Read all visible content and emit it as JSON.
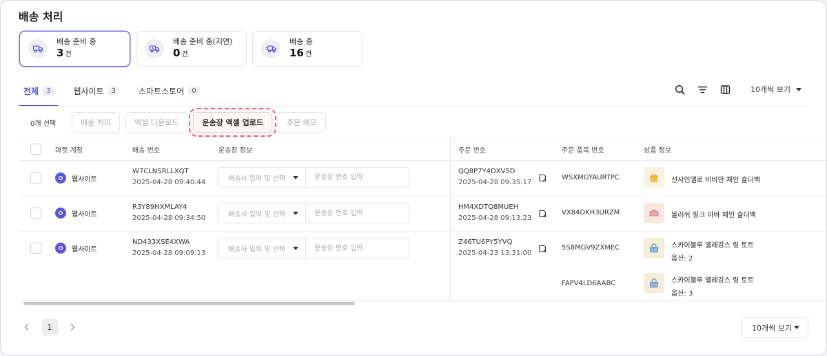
{
  "page": {
    "title": "배송 처리"
  },
  "status_cards": [
    {
      "label": "배송 준비 중",
      "count": "3",
      "unit": "건",
      "active": true,
      "icon": "truck-icon"
    },
    {
      "label": "배송 준비 중(지연)",
      "count": "0",
      "unit": "건",
      "active": false,
      "icon": "truck-delay-icon"
    },
    {
      "label": "배송 중",
      "count": "16",
      "unit": "건",
      "active": false,
      "icon": "truck-moving-icon"
    }
  ],
  "tabs": [
    {
      "label": "전체",
      "count": "3",
      "active": true
    },
    {
      "label": "웹사이트",
      "count": "3",
      "active": false
    },
    {
      "label": "스마트스토어",
      "count": "0",
      "active": false
    }
  ],
  "toolbar": {
    "view_select": "10개씩 보기"
  },
  "actions": {
    "selected_count": "0개 선택",
    "ship_process": "배송 처리",
    "excel_download": "엑셀 다운로드",
    "waybill_upload": "운송장 엑셀 업로드",
    "order_memo": "주문 메모"
  },
  "table": {
    "headers": {
      "market": "마켓 계정",
      "ship_no": "배송 번호",
      "waybill": "운송장 정보",
      "order_no": "주문 번호",
      "item_no": "주문 품목 번호",
      "product": "상품 정보"
    },
    "carrier_placeholder": "배송사 입력 및 선택",
    "tracking_placeholder": "운송장 번호 입력",
    "rows": [
      {
        "market": "웹사이트",
        "ship_no": "W7CLNSRLLXQT",
        "ship_time": "2025-04-28 09:40:44",
        "order_no": "QQ8P7Y4DXV5D",
        "order_time": "2025-04-28 09:35:17",
        "items": [
          {
            "item_no": "WSXMGYAURTPC",
            "product": "선사인옐로 비비안 체인 숄더백",
            "option": ""
          }
        ]
      },
      {
        "market": "웹사이트",
        "ship_no": "R3Y89HXMLAY4",
        "ship_time": "2025-04-28 09:34:50",
        "order_no": "HM4XDTQ8MUEH",
        "order_time": "2025-04-28 09:13:23",
        "items": [
          {
            "item_no": "VX84DKH3URZM",
            "product": "블러쉬 핑크 아바 체인 숄더백",
            "option": ""
          }
        ]
      },
      {
        "market": "웹사이트",
        "ship_no": "ND433XSE4XWA",
        "ship_time": "2025-04-28 09:09:13",
        "order_no": "Z46TU6PY5YVQ",
        "order_time": "2025-04-23 13:31:00",
        "items": [
          {
            "item_no": "5S8MGV9ZXMEC",
            "product": "스카이블루 엘레강스 링 토트",
            "option": "옵션: 2"
          },
          {
            "item_no": "FAPV4LD6AABC",
            "product": "스카이블루 엘레강스 링 토트",
            "option": "옵션: 3"
          }
        ]
      }
    ]
  },
  "pagination": {
    "current": "1",
    "per_page": "10개씩 보기"
  },
  "colors": {
    "accent": "#5c54e0",
    "highlight": "#e6607a"
  }
}
